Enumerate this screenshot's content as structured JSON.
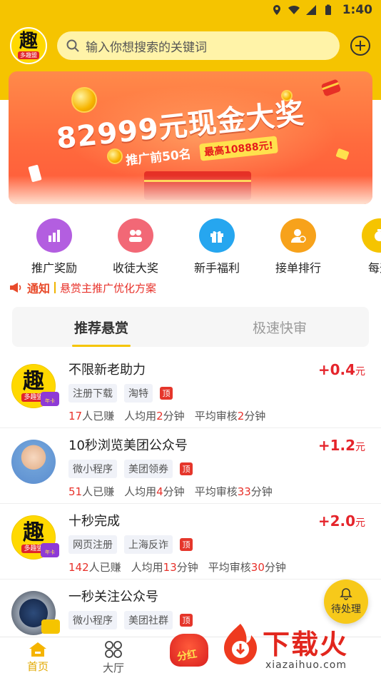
{
  "status_bar": {
    "time": "1:40",
    "icons": [
      "location-icon",
      "wifi-icon",
      "signal-icon",
      "battery-icon"
    ]
  },
  "header": {
    "logo_text": "趣",
    "logo_sub": "多趣盟",
    "search_placeholder": "输入你想搜索的关键词",
    "add_icon": "plus-circle-icon"
  },
  "banner": {
    "title": "82999元现金大奖",
    "subtitle": "推广前50名",
    "highlight": "最高10888元!"
  },
  "categories": [
    {
      "label": "推广奖励",
      "icon": "bar-chart-icon",
      "color": "#b35ee0"
    },
    {
      "label": "收徒大奖",
      "icon": "group-icon",
      "color": "#f26876"
    },
    {
      "label": "新手福利",
      "icon": "gift-icon",
      "color": "#26a6ef"
    },
    {
      "label": "接单排行",
      "icon": "user-rank-icon",
      "color": "#f7a21b"
    },
    {
      "label": "每天",
      "icon": "daily-icon",
      "color": "#f5c400"
    }
  ],
  "notice": {
    "label": "通知",
    "text": "悬赏主推广优化方案"
  },
  "tabs": [
    {
      "label": "推荐悬赏",
      "active": true
    },
    {
      "label": "极速快审",
      "active": false
    }
  ],
  "tasks": [
    {
      "title": "不限新老助力",
      "tags": [
        "注册下载",
        "淘特"
      ],
      "top_badge": "顶",
      "reward": "+0.4",
      "unit": "元",
      "earned_num": "17",
      "earned_text": "人已赚",
      "avg_time_prefix": "人均用",
      "avg_time_num": "2",
      "avg_time_unit": "分钟",
      "review_prefix": "平均审核",
      "review_num": "2",
      "review_unit": "分钟",
      "avatar": "qu",
      "avatar_text": "趣",
      "avatar_sub": "多趣盟",
      "crown_text": "年卡"
    },
    {
      "title": "10秒浏览美团公众号",
      "tags": [
        "微小程序",
        "美团领券"
      ],
      "top_badge": "顶",
      "reward": "+1.2",
      "unit": "元",
      "earned_num": "51",
      "earned_text": "人已赚",
      "avg_time_prefix": "人均用",
      "avg_time_num": "4",
      "avg_time_unit": "分钟",
      "review_prefix": "平均审核",
      "review_num": "33",
      "review_unit": "分钟",
      "avatar": "person"
    },
    {
      "title": "十秒完成",
      "tags": [
        "网页注册",
        "上海反诈"
      ],
      "top_badge": "顶",
      "reward": "+2.0",
      "unit": "元",
      "earned_num": "142",
      "earned_text": "人已赚",
      "avg_time_prefix": "人均用",
      "avg_time_num": "13",
      "avg_time_unit": "分钟",
      "review_prefix": "平均审核",
      "review_num": "30",
      "review_unit": "分钟",
      "avatar": "qu",
      "avatar_text": "趣",
      "avatar_sub": "多趣盟",
      "crown_text": "年卡"
    },
    {
      "title": "一秒关注公众号",
      "tags": [
        "微小程序",
        "美团社群"
      ],
      "top_badge": "顶",
      "avatar": "watch"
    }
  ],
  "pending": {
    "label": "待处理",
    "icon": "bell-icon"
  },
  "bottom_nav": [
    {
      "label": "首页",
      "icon": "home-icon",
      "active": true
    },
    {
      "label": "大厅",
      "icon": "grid-icon",
      "active": false
    }
  ],
  "fenhong": {
    "label": "分红"
  },
  "watermark": {
    "title": "下载火",
    "url": "xiazaihuo.com"
  },
  "colors": {
    "brand_yellow": "#f5c400",
    "reward_red": "#e5242b",
    "notice_red": "#e8312a"
  }
}
